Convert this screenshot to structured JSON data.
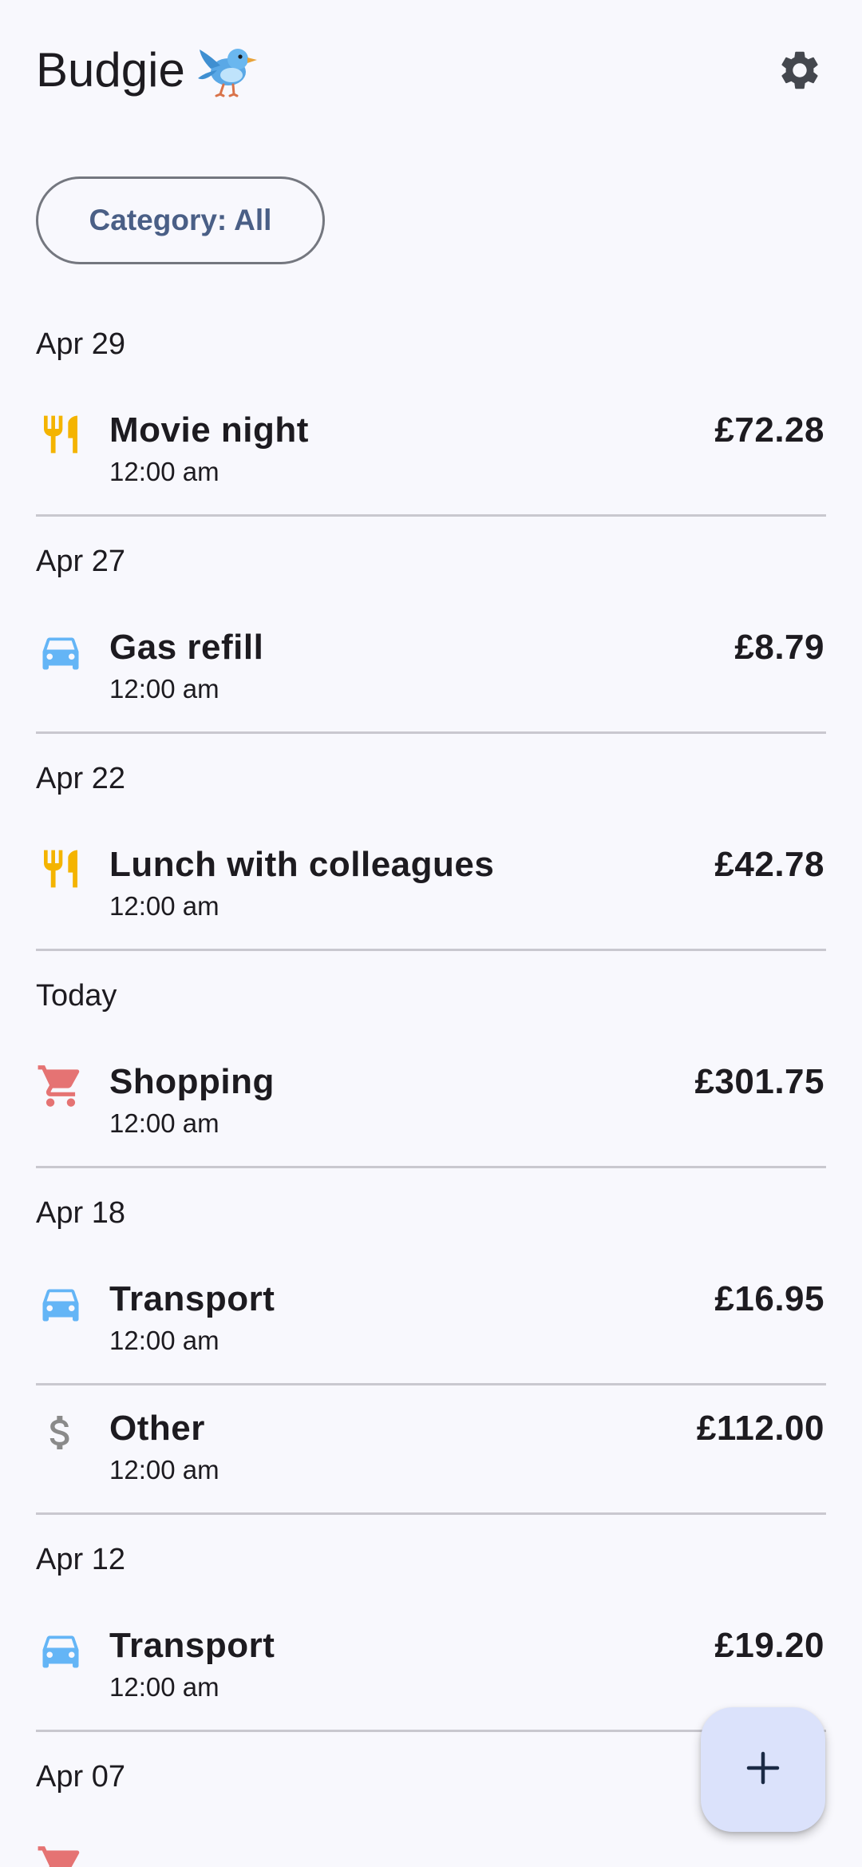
{
  "app": {
    "title": "Budgie",
    "logo_icon": "bird-emoji-icon",
    "settings_icon": "gear-icon"
  },
  "filter": {
    "label": "Category: All"
  },
  "colors": {
    "food": "#f4b400",
    "transport": "#64b5f6",
    "shopping": "#e57373",
    "other": "#8a8a8a",
    "chip_text": "#4a5f86",
    "fab_bg": "#dbe2fb"
  },
  "groups": [
    {
      "date": "Apr 29",
      "items": [
        {
          "category": "food",
          "icon": "fork-knife-icon",
          "title": "Movie night",
          "time": "12:00 am",
          "amount": "£72.28"
        }
      ]
    },
    {
      "date": "Apr 27",
      "items": [
        {
          "category": "transport",
          "icon": "car-icon",
          "title": "Gas refill",
          "time": "12:00 am",
          "amount": "£8.79"
        }
      ]
    },
    {
      "date": "Apr 22",
      "items": [
        {
          "category": "food",
          "icon": "fork-knife-icon",
          "title": "Lunch with colleagues",
          "time": "12:00 am",
          "amount": "£42.78"
        }
      ]
    },
    {
      "date": "Today",
      "items": [
        {
          "category": "shopping",
          "icon": "shopping-cart-icon",
          "title": "Shopping",
          "time": "12:00 am",
          "amount": "£301.75"
        }
      ]
    },
    {
      "date": "Apr 18",
      "items": [
        {
          "category": "transport",
          "icon": "car-icon",
          "title": "Transport",
          "time": "12:00 am",
          "amount": "£16.95"
        },
        {
          "category": "other",
          "icon": "dollar-icon",
          "title": "Other",
          "time": "12:00 am",
          "amount": "£112.00"
        }
      ]
    },
    {
      "date": "Apr 12",
      "items": [
        {
          "category": "transport",
          "icon": "car-icon",
          "title": "Transport",
          "time": "12:00 am",
          "amount": "£19.20"
        }
      ]
    },
    {
      "date": "Apr 07",
      "items": [
        {
          "category": "shopping",
          "icon": "shopping-cart-icon",
          "title": "",
          "time": "",
          "amount": ""
        }
      ]
    }
  ],
  "fab": {
    "icon": "plus-icon"
  }
}
